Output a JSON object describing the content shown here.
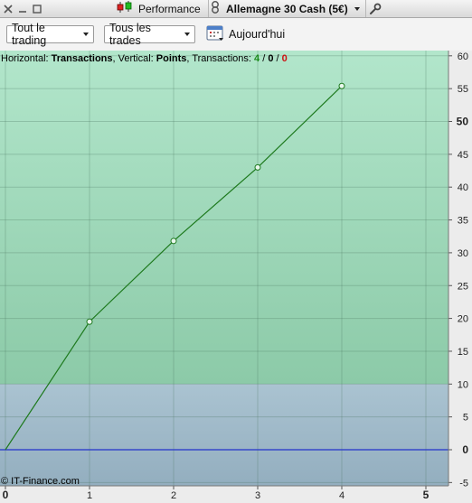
{
  "window": {
    "perf_label": "Performance",
    "instrument": "Allemagne 30 Cash (5€)"
  },
  "toolbar": {
    "filter1": "Tout le trading",
    "filter2": "Tous les trades",
    "date_label": "Aujourd'hui"
  },
  "legend": {
    "h_prefix": "Horizontal: ",
    "h_value": "Transactions",
    "v_prefix": ", Vertical: ",
    "v_value": "Points",
    "t_prefix": ", Transactions: ",
    "count_win": "4",
    "slash": " / ",
    "count_even": "0",
    "count_loss": "0"
  },
  "watermark": "© IT-Finance.com",
  "colors": {
    "profit_zone": "#a7e0c3",
    "loss_zone": "#a4bccc",
    "line": "#1e7a1e",
    "zero_line": "#2233cc",
    "win": "#1a8a1a",
    "loss": "#cc1111"
  },
  "chart_data": {
    "type": "line",
    "x": [
      0,
      1,
      2,
      3,
      4
    ],
    "y": [
      0,
      19.5,
      31.8,
      43,
      55.4
    ],
    "xlim": [
      0,
      5.3
    ],
    "ylim": [
      -5.5,
      61
    ],
    "x_ticks": [
      "0",
      "1",
      "2",
      "3",
      "4",
      "5"
    ],
    "x_major_ticks": [
      0,
      5
    ],
    "y_ticks": [
      "-5",
      "0",
      "5",
      "10",
      "15",
      "20",
      "25",
      "30",
      "35",
      "40",
      "45",
      "50",
      "55",
      "60"
    ],
    "y_major_ticks": [
      0,
      50
    ],
    "y_axis_position": "right",
    "grid": true
  }
}
